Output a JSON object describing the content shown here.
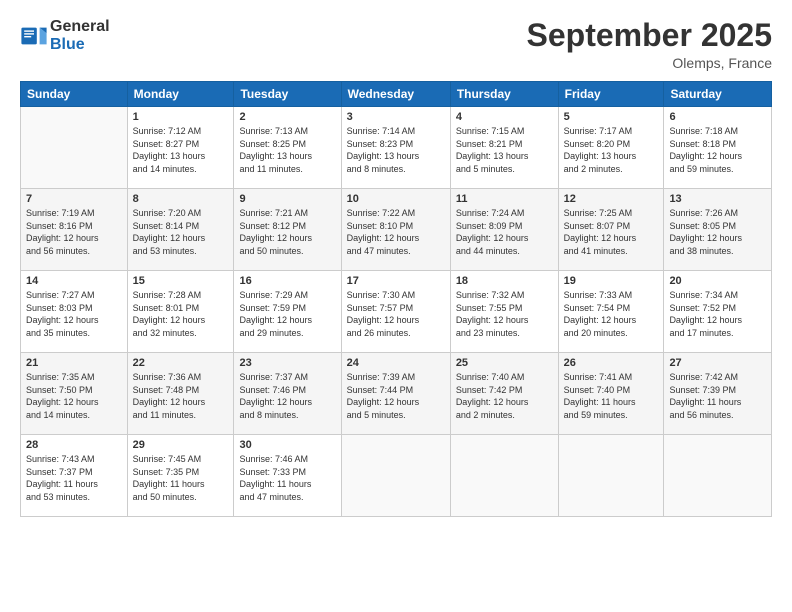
{
  "logo": {
    "general": "General",
    "blue": "Blue"
  },
  "header": {
    "month": "September 2025",
    "location": "Olemps, France"
  },
  "weekdays": [
    "Sunday",
    "Monday",
    "Tuesday",
    "Wednesday",
    "Thursday",
    "Friday",
    "Saturday"
  ],
  "weeks": [
    [
      {
        "day": "",
        "info": ""
      },
      {
        "day": "1",
        "info": "Sunrise: 7:12 AM\nSunset: 8:27 PM\nDaylight: 13 hours\nand 14 minutes."
      },
      {
        "day": "2",
        "info": "Sunrise: 7:13 AM\nSunset: 8:25 PM\nDaylight: 13 hours\nand 11 minutes."
      },
      {
        "day": "3",
        "info": "Sunrise: 7:14 AM\nSunset: 8:23 PM\nDaylight: 13 hours\nand 8 minutes."
      },
      {
        "day": "4",
        "info": "Sunrise: 7:15 AM\nSunset: 8:21 PM\nDaylight: 13 hours\nand 5 minutes."
      },
      {
        "day": "5",
        "info": "Sunrise: 7:17 AM\nSunset: 8:20 PM\nDaylight: 13 hours\nand 2 minutes."
      },
      {
        "day": "6",
        "info": "Sunrise: 7:18 AM\nSunset: 8:18 PM\nDaylight: 12 hours\nand 59 minutes."
      }
    ],
    [
      {
        "day": "7",
        "info": "Sunrise: 7:19 AM\nSunset: 8:16 PM\nDaylight: 12 hours\nand 56 minutes."
      },
      {
        "day": "8",
        "info": "Sunrise: 7:20 AM\nSunset: 8:14 PM\nDaylight: 12 hours\nand 53 minutes."
      },
      {
        "day": "9",
        "info": "Sunrise: 7:21 AM\nSunset: 8:12 PM\nDaylight: 12 hours\nand 50 minutes."
      },
      {
        "day": "10",
        "info": "Sunrise: 7:22 AM\nSunset: 8:10 PM\nDaylight: 12 hours\nand 47 minutes."
      },
      {
        "day": "11",
        "info": "Sunrise: 7:24 AM\nSunset: 8:09 PM\nDaylight: 12 hours\nand 44 minutes."
      },
      {
        "day": "12",
        "info": "Sunrise: 7:25 AM\nSunset: 8:07 PM\nDaylight: 12 hours\nand 41 minutes."
      },
      {
        "day": "13",
        "info": "Sunrise: 7:26 AM\nSunset: 8:05 PM\nDaylight: 12 hours\nand 38 minutes."
      }
    ],
    [
      {
        "day": "14",
        "info": "Sunrise: 7:27 AM\nSunset: 8:03 PM\nDaylight: 12 hours\nand 35 minutes."
      },
      {
        "day": "15",
        "info": "Sunrise: 7:28 AM\nSunset: 8:01 PM\nDaylight: 12 hours\nand 32 minutes."
      },
      {
        "day": "16",
        "info": "Sunrise: 7:29 AM\nSunset: 7:59 PM\nDaylight: 12 hours\nand 29 minutes."
      },
      {
        "day": "17",
        "info": "Sunrise: 7:30 AM\nSunset: 7:57 PM\nDaylight: 12 hours\nand 26 minutes."
      },
      {
        "day": "18",
        "info": "Sunrise: 7:32 AM\nSunset: 7:55 PM\nDaylight: 12 hours\nand 23 minutes."
      },
      {
        "day": "19",
        "info": "Sunrise: 7:33 AM\nSunset: 7:54 PM\nDaylight: 12 hours\nand 20 minutes."
      },
      {
        "day": "20",
        "info": "Sunrise: 7:34 AM\nSunset: 7:52 PM\nDaylight: 12 hours\nand 17 minutes."
      }
    ],
    [
      {
        "day": "21",
        "info": "Sunrise: 7:35 AM\nSunset: 7:50 PM\nDaylight: 12 hours\nand 14 minutes."
      },
      {
        "day": "22",
        "info": "Sunrise: 7:36 AM\nSunset: 7:48 PM\nDaylight: 12 hours\nand 11 minutes."
      },
      {
        "day": "23",
        "info": "Sunrise: 7:37 AM\nSunset: 7:46 PM\nDaylight: 12 hours\nand 8 minutes."
      },
      {
        "day": "24",
        "info": "Sunrise: 7:39 AM\nSunset: 7:44 PM\nDaylight: 12 hours\nand 5 minutes."
      },
      {
        "day": "25",
        "info": "Sunrise: 7:40 AM\nSunset: 7:42 PM\nDaylight: 12 hours\nand 2 minutes."
      },
      {
        "day": "26",
        "info": "Sunrise: 7:41 AM\nSunset: 7:40 PM\nDaylight: 11 hours\nand 59 minutes."
      },
      {
        "day": "27",
        "info": "Sunrise: 7:42 AM\nSunset: 7:39 PM\nDaylight: 11 hours\nand 56 minutes."
      }
    ],
    [
      {
        "day": "28",
        "info": "Sunrise: 7:43 AM\nSunset: 7:37 PM\nDaylight: 11 hours\nand 53 minutes."
      },
      {
        "day": "29",
        "info": "Sunrise: 7:45 AM\nSunset: 7:35 PM\nDaylight: 11 hours\nand 50 minutes."
      },
      {
        "day": "30",
        "info": "Sunrise: 7:46 AM\nSunset: 7:33 PM\nDaylight: 11 hours\nand 47 minutes."
      },
      {
        "day": "",
        "info": ""
      },
      {
        "day": "",
        "info": ""
      },
      {
        "day": "",
        "info": ""
      },
      {
        "day": "",
        "info": ""
      }
    ]
  ]
}
